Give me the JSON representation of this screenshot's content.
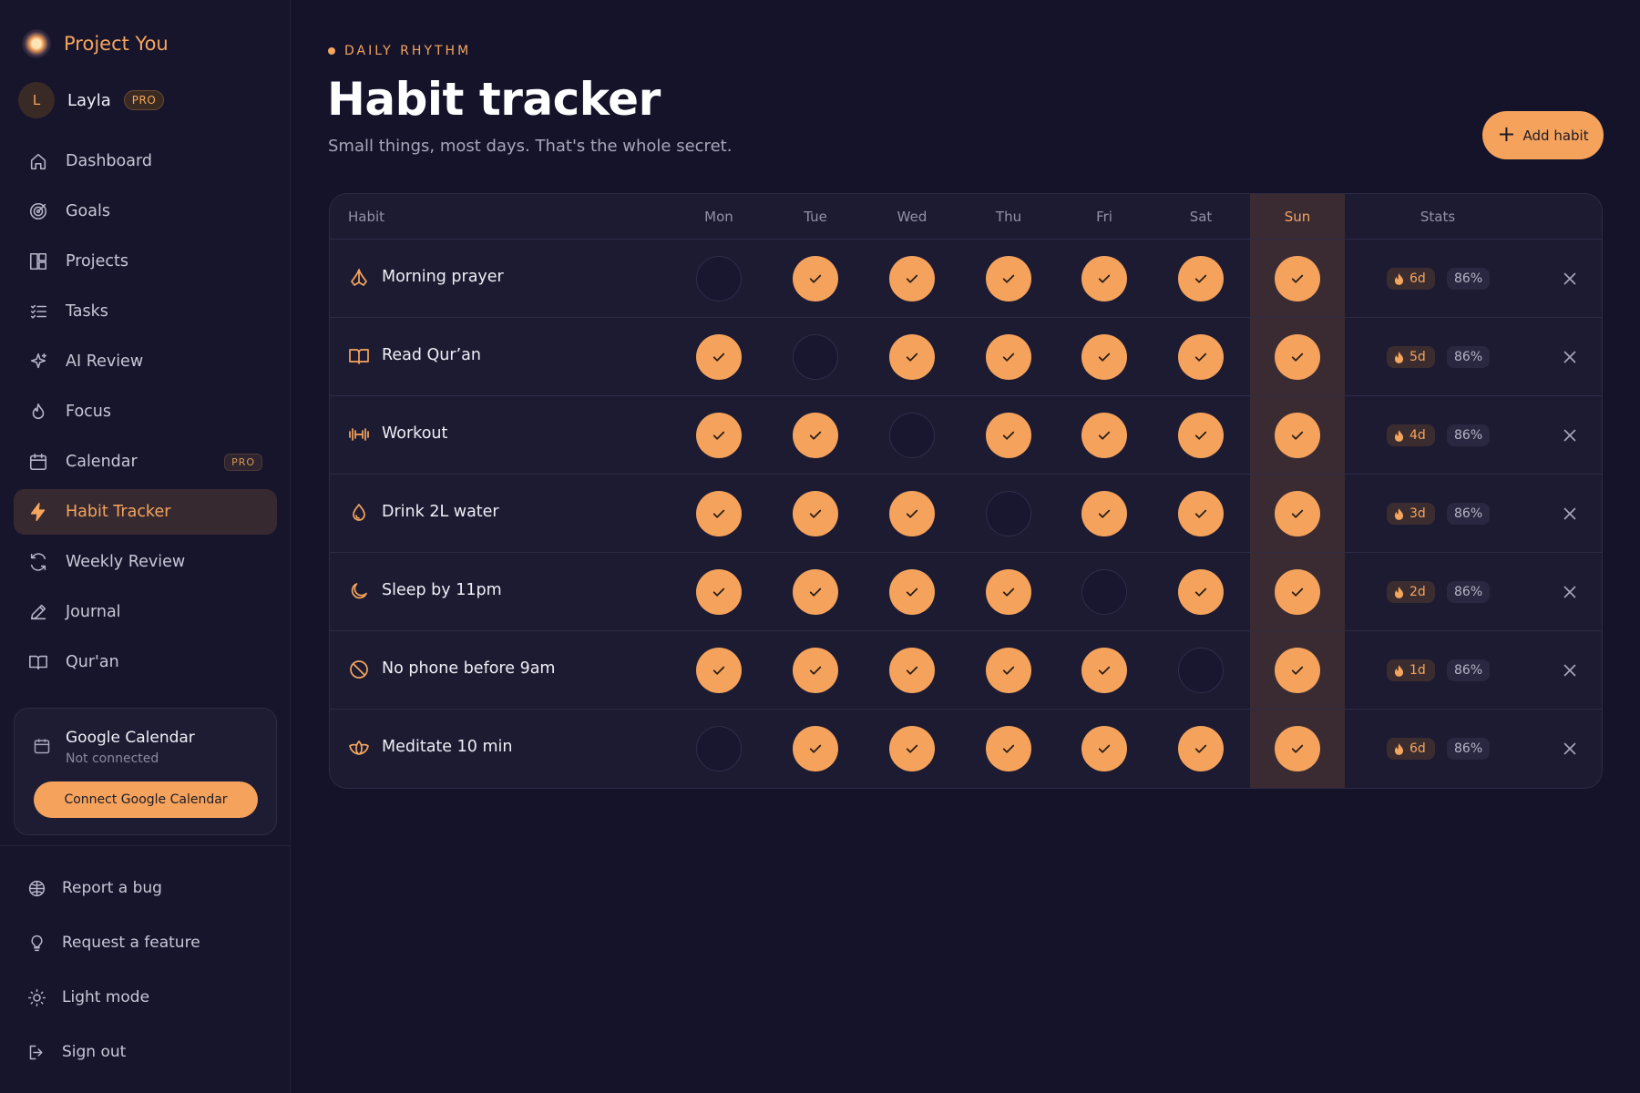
{
  "app": {
    "name": "Project You"
  },
  "user": {
    "initial": "L",
    "name": "Layla",
    "badge": "PRO"
  },
  "nav": [
    {
      "label": "Dashboard",
      "icon": "home-icon"
    },
    {
      "label": "Goals",
      "icon": "target-icon"
    },
    {
      "label": "Projects",
      "icon": "grid-icon"
    },
    {
      "label": "Tasks",
      "icon": "checklist-icon"
    },
    {
      "label": "AI Review",
      "icon": "sparkle-icon"
    },
    {
      "label": "Focus",
      "icon": "flame-icon"
    },
    {
      "label": "Calendar",
      "icon": "calendar-icon",
      "badge": "PRO"
    },
    {
      "label": "Habit Tracker",
      "icon": "bolt-icon",
      "active": true
    },
    {
      "label": "Weekly Review",
      "icon": "refresh-icon"
    },
    {
      "label": "Journal",
      "icon": "pencil-icon"
    },
    {
      "label": "Qur'an",
      "icon": "book-icon"
    }
  ],
  "gcal": {
    "title": "Google Calendar",
    "status": "Not connected",
    "button": "Connect Google Calendar"
  },
  "bottom_nav": [
    {
      "label": "Report a bug",
      "icon": "bug-icon"
    },
    {
      "label": "Request a feature",
      "icon": "lightbulb-icon"
    },
    {
      "label": "Light mode",
      "icon": "sun-icon"
    },
    {
      "label": "Sign out",
      "icon": "sign-out-icon"
    }
  ],
  "header": {
    "eyebrow": "DAILY RHYTHM",
    "title": "Habit tracker",
    "subtitle": "Small things, most days. That's the whole secret.",
    "add_button": "Add habit"
  },
  "table": {
    "columns": {
      "habit": "Habit",
      "days": [
        "Mon",
        "Tue",
        "Wed",
        "Thu",
        "Fri",
        "Sat",
        "Sun"
      ],
      "stats": "Stats"
    },
    "today_index": 6,
    "rows": [
      {
        "name": "Morning prayer",
        "icon": "praying-hands-icon",
        "days": [
          false,
          true,
          true,
          true,
          true,
          true,
          true
        ],
        "streak": "6d",
        "percent": "86%"
      },
      {
        "name": "Read Qur’an",
        "icon": "open-book-icon",
        "days": [
          true,
          false,
          true,
          true,
          true,
          true,
          true
        ],
        "streak": "5d",
        "percent": "86%"
      },
      {
        "name": "Workout",
        "icon": "dumbbell-icon",
        "days": [
          true,
          true,
          false,
          true,
          true,
          true,
          true
        ],
        "streak": "4d",
        "percent": "86%"
      },
      {
        "name": "Drink 2L water",
        "icon": "droplet-icon",
        "days": [
          true,
          true,
          true,
          false,
          true,
          true,
          true
        ],
        "streak": "3d",
        "percent": "86%"
      },
      {
        "name": "Sleep by 11pm",
        "icon": "moon-icon",
        "days": [
          true,
          true,
          true,
          true,
          false,
          true,
          true
        ],
        "streak": "2d",
        "percent": "86%"
      },
      {
        "name": "No phone before 9am",
        "icon": "ban-icon",
        "days": [
          true,
          true,
          true,
          true,
          true,
          false,
          true
        ],
        "streak": "1d",
        "percent": "86%"
      },
      {
        "name": "Meditate 10 min",
        "icon": "lotus-icon",
        "days": [
          false,
          true,
          true,
          true,
          true,
          true,
          true
        ],
        "streak": "6d",
        "percent": "86%"
      }
    ]
  },
  "colors": {
    "accent": "#f5a35c",
    "background": "#15132a",
    "today_column": "#3a2b33"
  }
}
